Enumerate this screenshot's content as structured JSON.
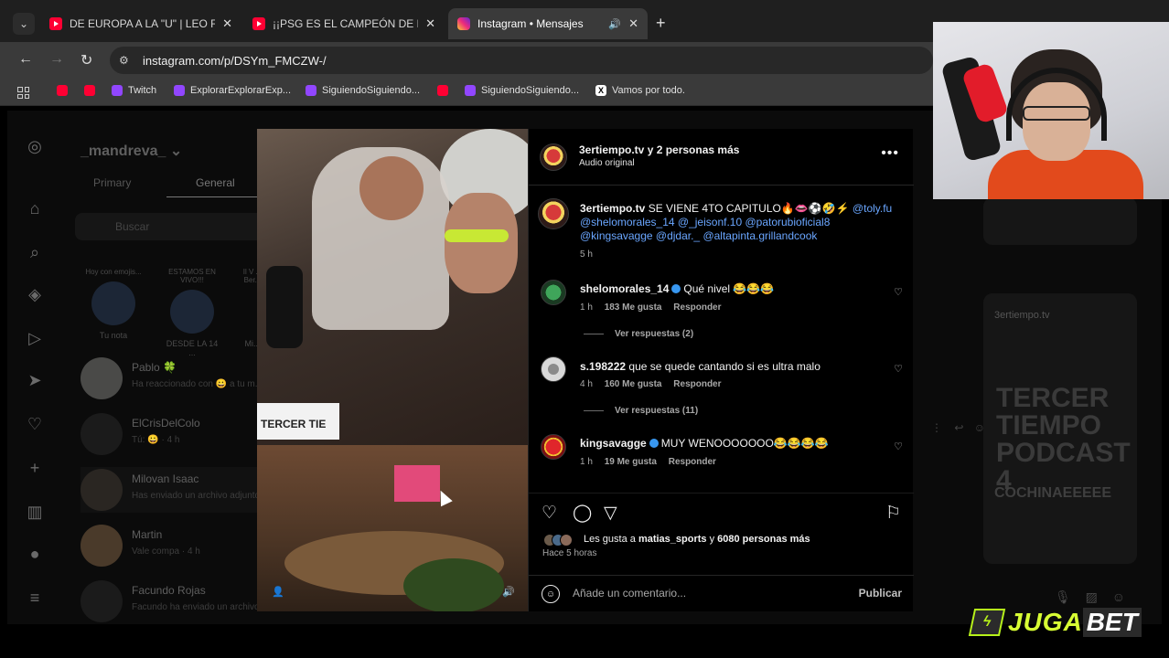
{
  "browser": {
    "tabs": [
      {
        "label": "DE EUROPA A LA \"U\" | LEO ROD",
        "icon": "youtube-icon"
      },
      {
        "label": "¡¡PSG ES EL CAMPEÓN DE LA #",
        "icon": "youtube-icon"
      },
      {
        "label": "Instagram • Mensajes",
        "icon": "instagram-icon",
        "active": true
      }
    ],
    "url": "instagram.com/p/DSYm_FMCZW-/",
    "bookmarks": [
      {
        "label": "",
        "icon": "youtube-icon"
      },
      {
        "label": "",
        "icon": "youtube-icon"
      },
      {
        "label": "Twitch",
        "icon": "twitch-icon"
      },
      {
        "label": "ExplorarExplorarExp...",
        "icon": "twitch-icon"
      },
      {
        "label": "SiguiendoSiguiendo...",
        "icon": "twitch-icon"
      },
      {
        "label": "",
        "icon": "youtube-icon"
      },
      {
        "label": "SiguiendoSiguiendo...",
        "icon": "twitch-icon"
      },
      {
        "label": "Vamos por todo.",
        "icon": "x-icon"
      }
    ]
  },
  "inbox": {
    "username": "_mandreva_",
    "tabs": [
      "Primary",
      "General"
    ],
    "search_placeholder": "Buscar",
    "notes": [
      {
        "text": "Hoy con emojis...",
        "caption": "Tu nota"
      },
      {
        "text": "ESTAMOS EN VIVO!!!",
        "caption": "DESDE LA 14 ..."
      },
      {
        "text": "Il V ... Ber...",
        "caption": "Mi..."
      }
    ],
    "chats": [
      {
        "name": "Pablo 🍀",
        "sub": "Ha reaccionado con 😀 a tu m..."
      },
      {
        "name": "ElCrisDelColo",
        "sub": "Tú: 😀 · 4 h"
      },
      {
        "name": "Milovan Isaac",
        "sub": "Has enviado un archivo adjunto"
      },
      {
        "name": "Martin",
        "sub": "Vale compa · 4 h"
      },
      {
        "name": "Facundo Rojas",
        "sub": "Facundo ha enviado un archivo..."
      }
    ],
    "right_preview": {
      "header": "3ertiempo.tv",
      "title": "TERCER TIEMPO PODCAST 4",
      "subtitle": "COCHINAEEEEE"
    }
  },
  "post": {
    "media_sign": "TERCER TIE",
    "header": {
      "name": "3ertiempo.tv y 2 personas más",
      "sub": "Audio original"
    },
    "caption": {
      "user": "3ertiempo.tv",
      "text": "SE VIENE 4TO CAPITULO🔥👄⚽️🤣⚡️",
      "mentions": "@toly.fu @shelomorales_14 @_jeisonf.10 @patorubioficial8 @kingsavagge @djdar._ @altapinta.grillandcook",
      "time": "5 h"
    },
    "comments": [
      {
        "user": "shelomorales_14",
        "verified": true,
        "text": "Qué nivel 😂😂😂",
        "time": "1 h",
        "likes": "183 Me gusta",
        "reply": "Responder",
        "view_replies": "Ver respuestas (2)"
      },
      {
        "user": "s.198222",
        "verified": false,
        "text": "que se quede cantando si es ultra malo",
        "time": "4 h",
        "likes": "160 Me gusta",
        "reply": "Responder",
        "view_replies": "Ver respuestas (11)"
      },
      {
        "user": "kingsavagge",
        "verified": true,
        "text": "MUY WENOOOOOOO😂😂😂😂",
        "time": "1 h",
        "likes": "19 Me gusta",
        "reply": "Responder",
        "view_replies": ""
      }
    ],
    "likes_line": {
      "prefix": "Les gusta a ",
      "user": "matias_sports",
      "middle": " y ",
      "count": "6080 personas más"
    },
    "ago": "Hace 5 horas",
    "comment_placeholder": "Añade un comentario...",
    "publish": "Publicar"
  },
  "sponsor": {
    "part1": "JUGA",
    "part2": "BET"
  }
}
